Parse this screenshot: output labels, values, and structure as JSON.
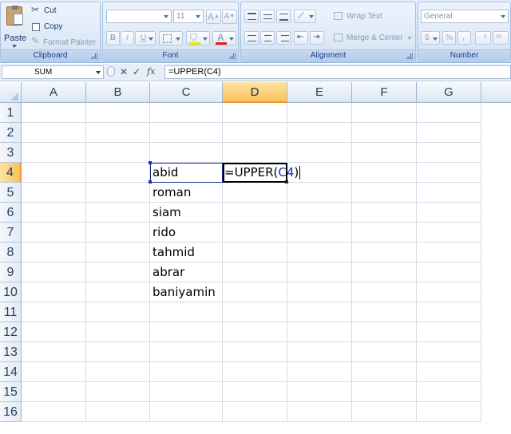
{
  "ribbon": {
    "clipboard": {
      "paste_label": "Paste",
      "cut_label": "Cut",
      "copy_label": "Copy",
      "format_painter_label": "Format Painter",
      "group_label": "Clipboard"
    },
    "font": {
      "font_name_value": "",
      "font_size_value": "11",
      "grow_label": "A",
      "shrink_label": "A",
      "bold_label": "B",
      "italic_label": "I",
      "underline_label": "U",
      "font_color_label": "A",
      "group_label": "Font"
    },
    "alignment": {
      "wrap_text_label": "Wrap Text",
      "merge_center_label": "Merge & Center",
      "group_label": "Alignment"
    },
    "number": {
      "format_value": "General",
      "currency_label": "$",
      "percent_label": "%",
      "group_label": "Number"
    }
  },
  "formula_bar": {
    "name_box": "SUM",
    "fx_label": "fx",
    "cancel_label": "✕",
    "enter_label": "✓",
    "formula": "=UPPER(C4)"
  },
  "columns": [
    "A",
    "B",
    "C",
    "D",
    "E",
    "F",
    "G"
  ],
  "rows": [
    "1",
    "2",
    "3",
    "4",
    "5",
    "6",
    "7",
    "8",
    "9",
    "10",
    "11",
    "12",
    "13",
    "14",
    "15",
    "16"
  ],
  "cells": {
    "C4": "abid",
    "C5": "roman",
    "C6": "siam",
    "C7": "rido",
    "C8": "tahmid",
    "C9": "abrar",
    "C10": "baniyamin",
    "D4_prefix": "=UPPER(",
    "D4_ref": "C4",
    "D4_suffix": ")"
  },
  "colors": {
    "active_header": "#f7c25c",
    "reference_blue": "#1a2fb8",
    "ribbon_label": "#15428b"
  }
}
